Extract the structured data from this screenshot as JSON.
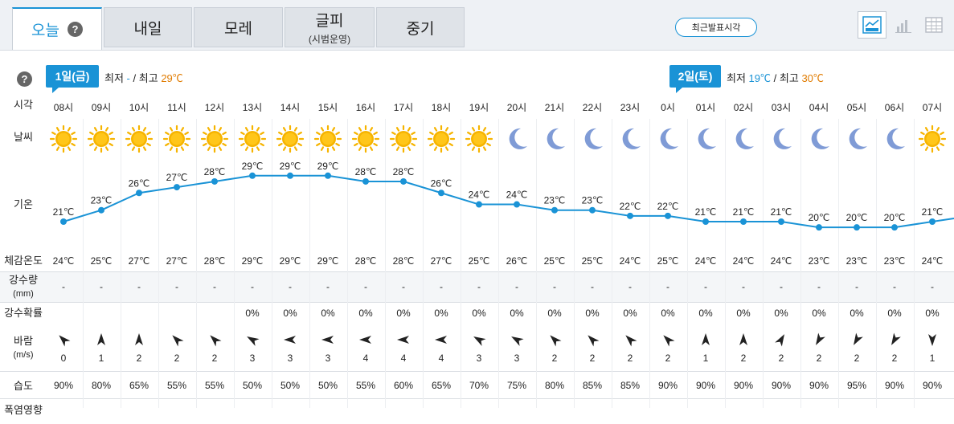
{
  "tabs": [
    {
      "label": "오늘",
      "sub": ""
    },
    {
      "label": "내일",
      "sub": ""
    },
    {
      "label": "모레",
      "sub": ""
    },
    {
      "label": "글피",
      "sub": "(시범운영)"
    },
    {
      "label": "중기",
      "sub": ""
    }
  ],
  "help_icon": "question-icon",
  "recent_button": "최근발표시각",
  "view_icons": [
    "line-graph-icon",
    "bar-chart-icon",
    "table-icon"
  ],
  "days": [
    {
      "label": "1일(금)",
      "min_label": "최저",
      "min": "-",
      "sep": "/",
      "max_label": "최고",
      "max": "29℃"
    },
    {
      "label": "2일(토)",
      "min_label": "최저",
      "min": "19℃",
      "sep": "/",
      "max_label": "최고",
      "max": "30℃"
    }
  ],
  "row_labels": {
    "time": "시각",
    "weather": "날씨",
    "temp": "기온",
    "feels": "체감온도",
    "precip": "강수량",
    "precip_unit": "(mm)",
    "prob": "강수확률",
    "wind": "바람",
    "wind_unit": "(m/s)",
    "humidity": "습도",
    "heat": "폭염영향"
  },
  "colors": {
    "accent": "#1a93d6",
    "max": "#e07b00",
    "sun": "#f6b400",
    "moon": "#7f9bd6"
  },
  "hours": [
    {
      "time": "08시",
      "icon": "sun",
      "temp": 21,
      "temp_label": "21℃",
      "feels": "24℃",
      "precip": "-",
      "prob": "",
      "wind_dir": "arrow-se",
      "wind_deg": 135,
      "wind": "0",
      "humidity": "90%"
    },
    {
      "time": "09시",
      "icon": "sun",
      "temp": 23,
      "temp_label": "23℃",
      "feels": "25℃",
      "precip": "-",
      "prob": "",
      "wind_dir": "arrow-s",
      "wind_deg": 180,
      "wind": "1",
      "humidity": "80%"
    },
    {
      "time": "10시",
      "icon": "sun",
      "temp": 26,
      "temp_label": "26℃",
      "feels": "27℃",
      "precip": "-",
      "prob": "",
      "wind_dir": "arrow-s",
      "wind_deg": 180,
      "wind": "2",
      "humidity": "65%"
    },
    {
      "time": "11시",
      "icon": "sun",
      "temp": 27,
      "temp_label": "27℃",
      "feels": "27℃",
      "precip": "-",
      "prob": "",
      "wind_dir": "arrow-se",
      "wind_deg": 135,
      "wind": "2",
      "humidity": "55%"
    },
    {
      "time": "12시",
      "icon": "sun",
      "temp": 28,
      "temp_label": "28℃",
      "feels": "28℃",
      "precip": "-",
      "prob": "",
      "wind_dir": "arrow-se",
      "wind_deg": 135,
      "wind": "2",
      "humidity": "55%"
    },
    {
      "time": "13시",
      "icon": "sun",
      "temp": 29,
      "temp_label": "29℃",
      "feels": "29℃",
      "precip": "-",
      "prob": "0%",
      "wind_dir": "arrow-se",
      "wind_deg": 120,
      "wind": "3",
      "humidity": "50%"
    },
    {
      "time": "14시",
      "icon": "sun",
      "temp": 29,
      "temp_label": "29℃",
      "feels": "29℃",
      "precip": "-",
      "prob": "0%",
      "wind_dir": "arrow-e",
      "wind_deg": 90,
      "wind": "3",
      "humidity": "50%"
    },
    {
      "time": "15시",
      "icon": "sun",
      "temp": 29,
      "temp_label": "29℃",
      "feels": "29℃",
      "precip": "-",
      "prob": "0%",
      "wind_dir": "arrow-e",
      "wind_deg": 90,
      "wind": "3",
      "humidity": "50%"
    },
    {
      "time": "16시",
      "icon": "sun",
      "temp": 28,
      "temp_label": "28℃",
      "feels": "28℃",
      "precip": "-",
      "prob": "0%",
      "wind_dir": "arrow-e",
      "wind_deg": 90,
      "wind": "4",
      "humidity": "55%"
    },
    {
      "time": "17시",
      "icon": "sun",
      "temp": 28,
      "temp_label": "28℃",
      "feels": "28℃",
      "precip": "-",
      "prob": "0%",
      "wind_dir": "arrow-e",
      "wind_deg": 90,
      "wind": "4",
      "humidity": "60%"
    },
    {
      "time": "18시",
      "icon": "sun",
      "temp": 26,
      "temp_label": "26℃",
      "feels": "27℃",
      "precip": "-",
      "prob": "0%",
      "wind_dir": "arrow-e",
      "wind_deg": 90,
      "wind": "4",
      "humidity": "65%"
    },
    {
      "time": "19시",
      "icon": "sun",
      "temp": 24,
      "temp_label": "24℃",
      "feels": "25℃",
      "precip": "-",
      "prob": "0%",
      "wind_dir": "arrow-se",
      "wind_deg": 120,
      "wind": "3",
      "humidity": "70%"
    },
    {
      "time": "20시",
      "icon": "moon",
      "temp": 24,
      "temp_label": "24℃",
      "feels": "26℃",
      "precip": "-",
      "prob": "0%",
      "wind_dir": "arrow-se",
      "wind_deg": 120,
      "wind": "3",
      "humidity": "75%"
    },
    {
      "time": "21시",
      "icon": "moon",
      "temp": 23,
      "temp_label": "23℃",
      "feels": "25℃",
      "precip": "-",
      "prob": "0%",
      "wind_dir": "arrow-se",
      "wind_deg": 135,
      "wind": "2",
      "humidity": "80%"
    },
    {
      "time": "22시",
      "icon": "moon",
      "temp": 23,
      "temp_label": "23℃",
      "feels": "25℃",
      "precip": "-",
      "prob": "0%",
      "wind_dir": "arrow-se",
      "wind_deg": 135,
      "wind": "2",
      "humidity": "85%"
    },
    {
      "time": "23시",
      "icon": "moon",
      "temp": 22,
      "temp_label": "22℃",
      "feels": "24℃",
      "precip": "-",
      "prob": "0%",
      "wind_dir": "arrow-se",
      "wind_deg": 135,
      "wind": "2",
      "humidity": "85%"
    },
    {
      "time": "0시",
      "icon": "moon",
      "temp": 22,
      "temp_label": "22℃",
      "feels": "25℃",
      "precip": "-",
      "prob": "0%",
      "wind_dir": "arrow-se",
      "wind_deg": 135,
      "wind": "2",
      "humidity": "90%"
    },
    {
      "time": "01시",
      "icon": "moon",
      "temp": 21,
      "temp_label": "21℃",
      "feels": "24℃",
      "precip": "-",
      "prob": "0%",
      "wind_dir": "arrow-s",
      "wind_deg": 180,
      "wind": "1",
      "humidity": "90%"
    },
    {
      "time": "02시",
      "icon": "moon",
      "temp": 21,
      "temp_label": "21℃",
      "feels": "24℃",
      "precip": "-",
      "prob": "0%",
      "wind_dir": "arrow-s",
      "wind_deg": 180,
      "wind": "2",
      "humidity": "90%"
    },
    {
      "time": "03시",
      "icon": "moon",
      "temp": 21,
      "temp_label": "21℃",
      "feels": "24℃",
      "precip": "-",
      "prob": "0%",
      "wind_dir": "arrow-sw",
      "wind_deg": 210,
      "wind": "2",
      "humidity": "90%"
    },
    {
      "time": "04시",
      "icon": "moon",
      "temp": 20,
      "temp_label": "20℃",
      "feels": "23℃",
      "precip": "-",
      "prob": "0%",
      "wind_dir": "arrow-ne",
      "wind_deg": 30,
      "wind": "2",
      "humidity": "90%"
    },
    {
      "time": "05시",
      "icon": "moon",
      "temp": 20,
      "temp_label": "20℃",
      "feels": "23℃",
      "precip": "-",
      "prob": "0%",
      "wind_dir": "arrow-ne",
      "wind_deg": 30,
      "wind": "2",
      "humidity": "95%"
    },
    {
      "time": "06시",
      "icon": "moon",
      "temp": 20,
      "temp_label": "20℃",
      "feels": "23℃",
      "precip": "-",
      "prob": "0%",
      "wind_dir": "arrow-ne",
      "wind_deg": 30,
      "wind": "2",
      "humidity": "90%"
    },
    {
      "time": "07시",
      "icon": "sun",
      "temp": 21,
      "temp_label": "21℃",
      "feels": "24℃",
      "precip": "-",
      "prob": "0%",
      "wind_dir": "arrow-n",
      "wind_deg": 0,
      "wind": "1",
      "humidity": "90%"
    }
  ]
}
